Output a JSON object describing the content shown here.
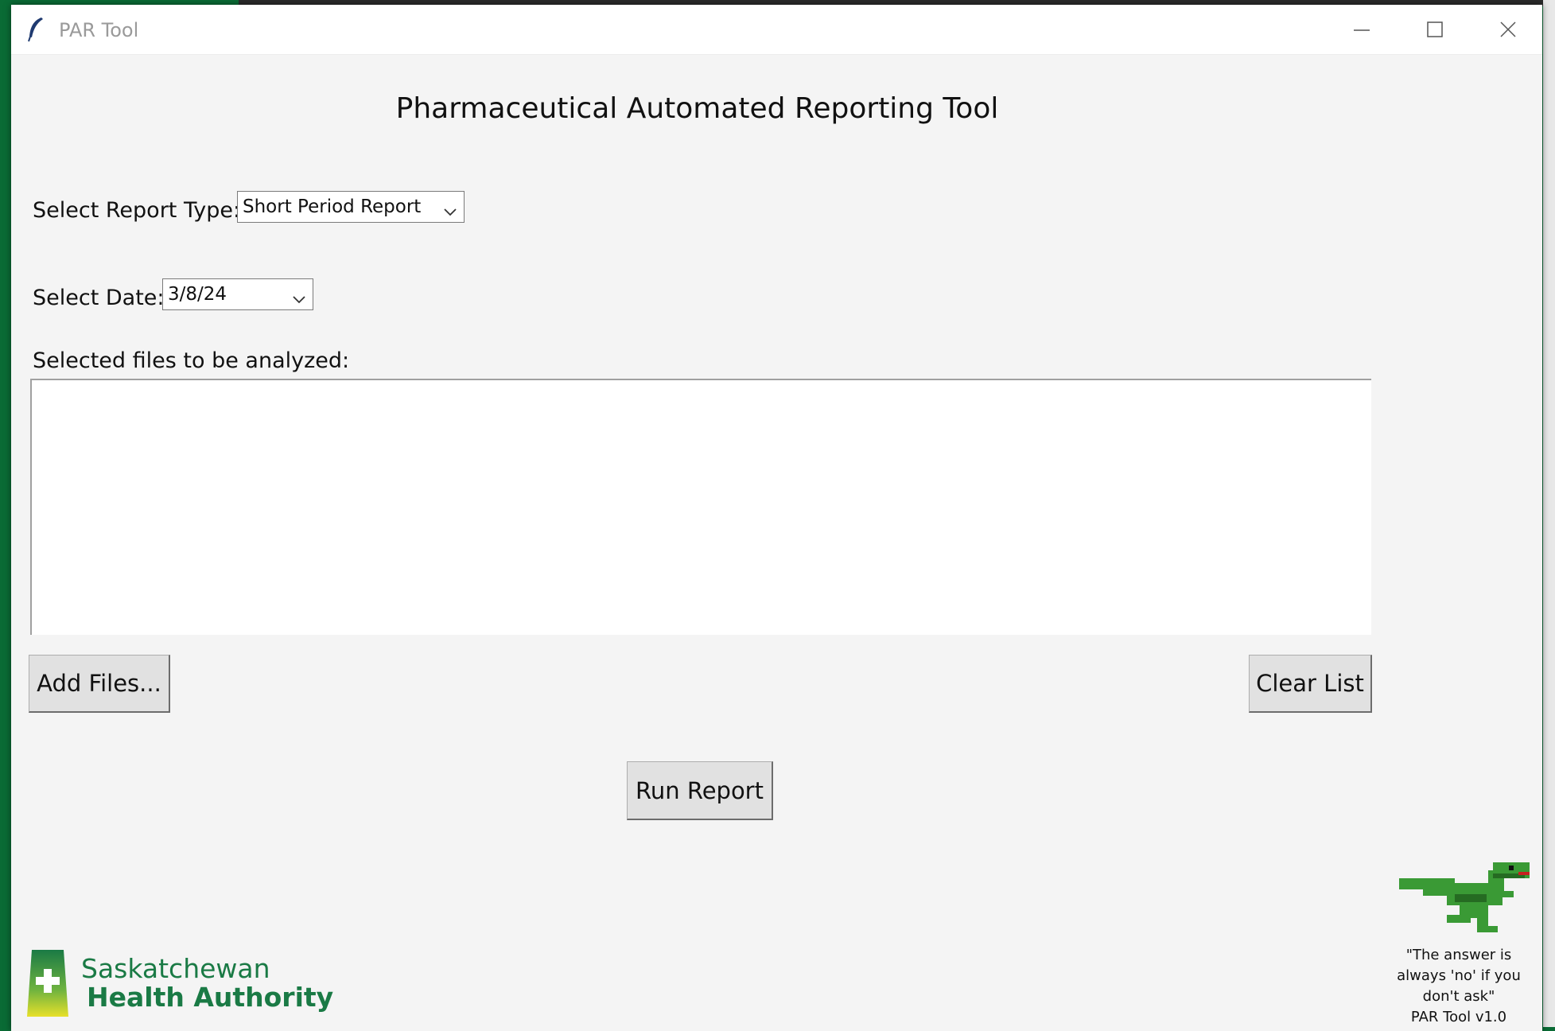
{
  "window": {
    "title": "PAR Tool",
    "icon": "feather-icon"
  },
  "main": {
    "heading": "Pharmaceutical Automated Reporting Tool",
    "report_type_label": "Select Report Type:",
    "report_type_value": "Short Period Report",
    "date_label": "Select Date:",
    "date_value": "3/8/24",
    "files_label": "Selected files to be analyzed:",
    "files": [],
    "add_files_label": "Add Files...",
    "clear_list_label": "Clear List",
    "run_report_label": "Run Report"
  },
  "footer": {
    "logo_line1": "Saskatchewan",
    "logo_line2": "Health Authority",
    "quote_line1": "\"The answer is",
    "quote_line2": "always 'no' if you",
    "quote_line3": "don't ask\"",
    "version": "PAR Tool v1.0"
  },
  "colors": {
    "brand_green": "#1a7a45",
    "background": "#f4f4f4",
    "desktop_green": "#0a6b35"
  }
}
